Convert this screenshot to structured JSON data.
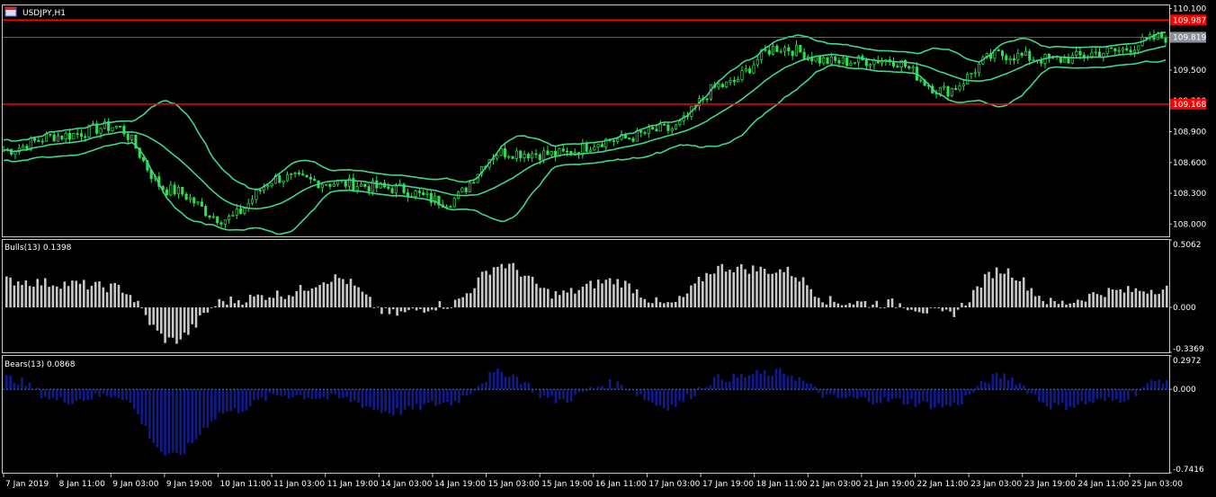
{
  "window": {
    "symbol_title": "USDJPY,H1"
  },
  "colors": {
    "background": "#000000",
    "bands": "#3dd68c",
    "candles": "#2ee050",
    "bulls": "#c8c8c8",
    "bears": "#101a8a",
    "hline": "#ff0000",
    "price_label_bg": "#ff0000",
    "current_label_bg": "#8a8f99"
  },
  "price_panel": {
    "ylim": [
      107.88,
      110.13
    ],
    "ticks": [
      "110.100",
      "109.500",
      "109.200",
      "108.900",
      "108.600",
      "108.300",
      "108.000"
    ],
    "tick_values": [
      110.1,
      109.5,
      109.2,
      108.9,
      108.6,
      108.3,
      108.0
    ],
    "hlines": [
      {
        "value": 109.987,
        "label": "109.987"
      },
      {
        "value": 109.168,
        "label": "109.168"
      }
    ],
    "current": {
      "value": 109.819,
      "label": "109.819"
    }
  },
  "bulls_panel": {
    "title": "Bulls(13) 0.1398",
    "ylim": [
      -0.3369,
      0.5062
    ],
    "ticks": [
      "0.5062",
      "0.000",
      "-0.3369"
    ],
    "tick_values": [
      0.5062,
      0.0,
      -0.3369
    ]
  },
  "bears_panel": {
    "title": "Bears(13) 0.0868",
    "ylim": [
      -0.7416,
      0.2972
    ],
    "ticks": [
      "0.2972",
      "0.000",
      "-0.7416"
    ],
    "tick_values": [
      0.2972,
      0.0,
      -0.7416
    ]
  },
  "x_axis": {
    "labels": [
      "7 Jan 2019",
      "8 Jan 11:00",
      "9 Jan 03:00",
      "9 Jan 19:00",
      "10 Jan 11:00",
      "11 Jan 03:00",
      "11 Jan 19:00",
      "14 Jan 03:00",
      "14 Jan 19:00",
      "15 Jan 03:00",
      "15 Jan 19:00",
      "16 Jan 11:00",
      "17 Jan 03:00",
      "17 Jan 19:00",
      "18 Jan 11:00",
      "21 Jan 03:00",
      "21 Jan 19:00",
      "22 Jan 11:00",
      "23 Jan 03:00",
      "23 Jan 19:00",
      "24 Jan 11:00",
      "25 Jan 03:00"
    ]
  },
  "chart_data": {
    "type": "line",
    "title": "USDJPY,H1",
    "x": [
      "7 Jan 2019",
      "8 Jan 11:00",
      "9 Jan 03:00",
      "9 Jan 19:00",
      "10 Jan 11:00",
      "11 Jan 03:00",
      "11 Jan 19:00",
      "14 Jan 03:00",
      "14 Jan 19:00",
      "15 Jan 03:00",
      "15 Jan 19:00",
      "16 Jan 11:00",
      "17 Jan 03:00",
      "17 Jan 19:00",
      "18 Jan 11:00",
      "21 Jan 03:00",
      "21 Jan 19:00",
      "22 Jan 11:00",
      "23 Jan 03:00",
      "23 Jan 19:00",
      "24 Jan 11:00",
      "25 Jan 03:00"
    ],
    "series": [
      {
        "name": "USDJPY",
        "values": [
          108.72,
          108.86,
          108.95,
          108.33,
          108.05,
          108.45,
          108.4,
          108.35,
          108.22,
          108.7,
          108.68,
          108.82,
          108.92,
          109.35,
          109.72,
          109.58,
          109.6,
          109.3,
          109.65,
          109.6,
          109.68,
          109.82
        ]
      },
      {
        "name": "Bulls(13)",
        "values": [
          0.2,
          0.18,
          0.15,
          -0.25,
          0.05,
          0.1,
          0.22,
          -0.05,
          0.02,
          0.32,
          0.1,
          0.2,
          0.02,
          0.3,
          0.28,
          0.04,
          0.03,
          -0.05,
          0.28,
          0.03,
          0.12,
          0.14
        ]
      },
      {
        "name": "Bears(13)",
        "values": [
          0.1,
          -0.1,
          -0.05,
          -0.6,
          -0.2,
          -0.05,
          -0.08,
          -0.2,
          -0.12,
          0.15,
          -0.1,
          0.05,
          -0.15,
          0.1,
          0.15,
          -0.08,
          -0.1,
          -0.15,
          0.12,
          -0.15,
          -0.1,
          0.09
        ]
      }
    ]
  }
}
